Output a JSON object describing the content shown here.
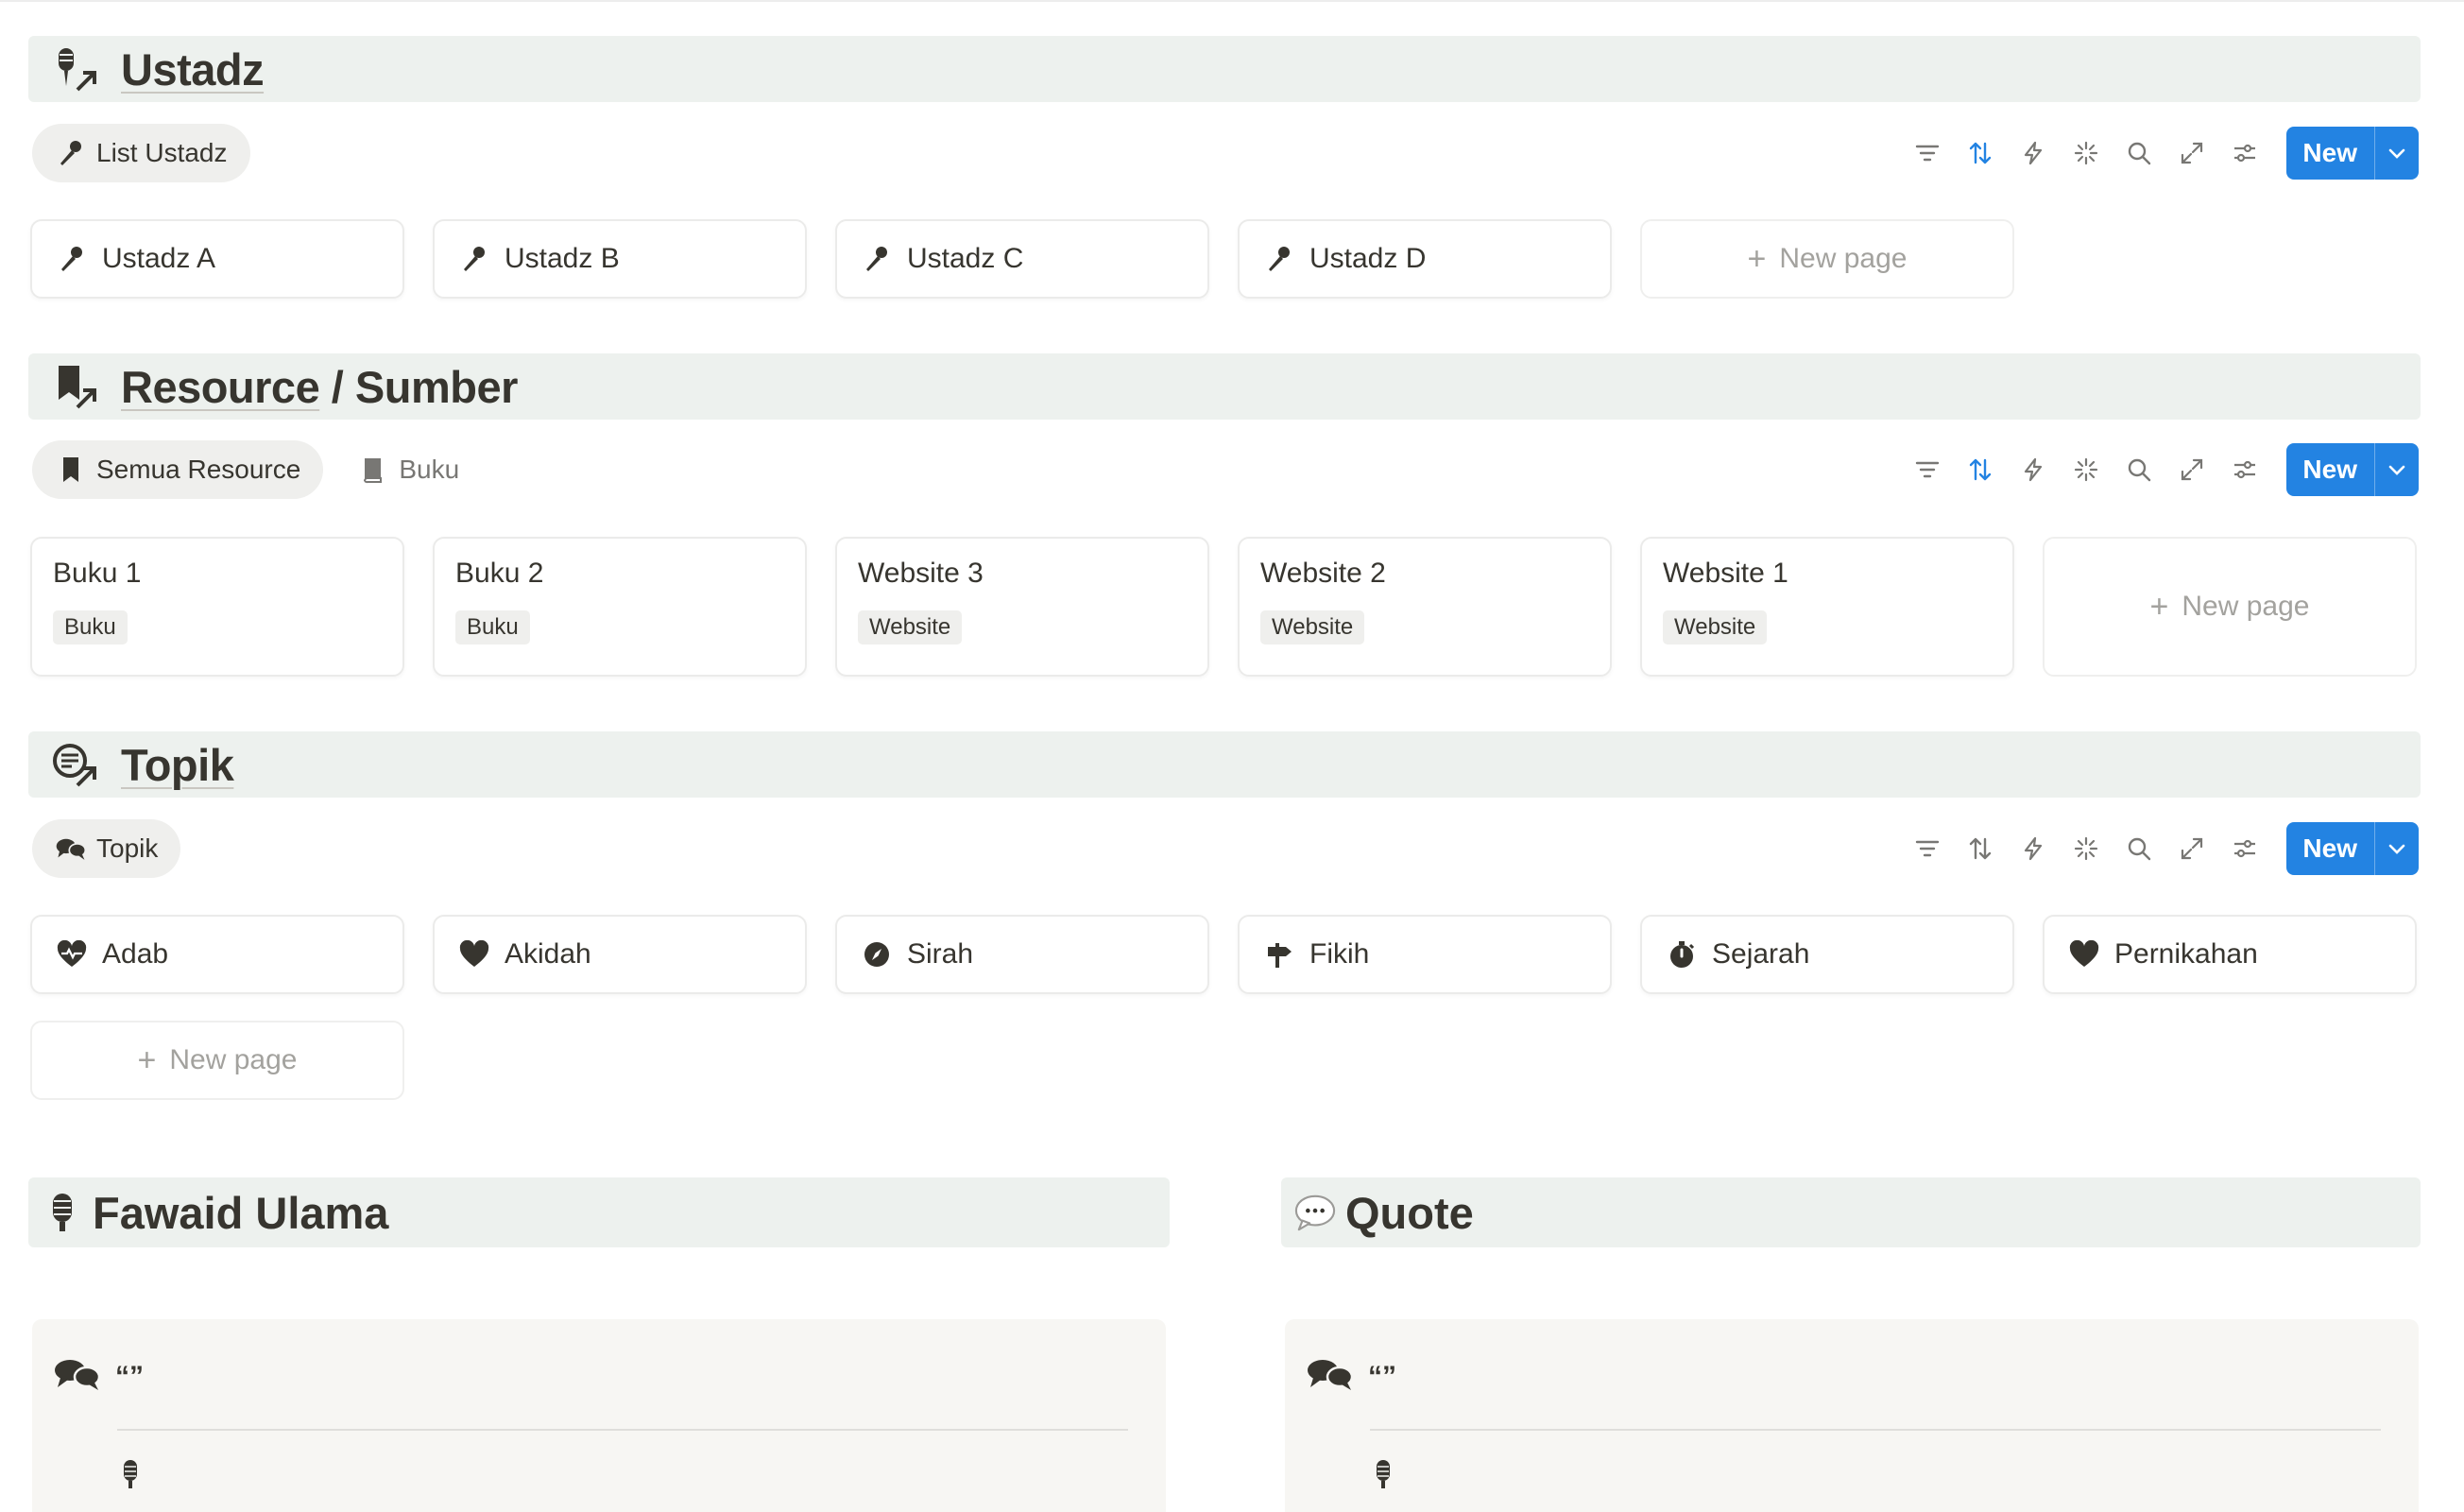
{
  "ustadz": {
    "title": "Ustadz",
    "tab": "List Ustadz",
    "items": [
      "Ustadz A",
      "Ustadz B",
      "Ustadz C",
      "Ustadz D"
    ],
    "new_page": "New page",
    "new_button": "New"
  },
  "resource": {
    "title_link": "Resource",
    "title_rest": " / Sumber",
    "tabs": [
      "Semua Resource",
      "Buku"
    ],
    "items": [
      {
        "title": "Buku 1",
        "tag": "Buku"
      },
      {
        "title": "Buku 2",
        "tag": "Buku"
      },
      {
        "title": "Website 3",
        "tag": "Website"
      },
      {
        "title": "Website 2",
        "tag": "Website"
      },
      {
        "title": "Website 1",
        "tag": "Website"
      }
    ],
    "new_page": "New page",
    "new_button": "New"
  },
  "topik": {
    "title": "Topik",
    "tab": "Topik",
    "items": [
      {
        "label": "Adab",
        "icon": "heart-pulse-icon"
      },
      {
        "label": "Akidah",
        "icon": "heart-icon"
      },
      {
        "label": "Sirah",
        "icon": "compass-icon"
      },
      {
        "label": "Fikih",
        "icon": "signpost-icon"
      },
      {
        "label": "Sejarah",
        "icon": "timer-icon"
      },
      {
        "label": "Pernikahan",
        "icon": "heart-icon"
      }
    ],
    "new_page": "New page",
    "new_button": "New"
  },
  "fawaid": {
    "title": "Fawaid Ulama",
    "quote": "“”"
  },
  "quote": {
    "title": "Quote",
    "quote": "“”"
  },
  "colors": {
    "accent": "#2383e2",
    "section_bg": "#edf1ee",
    "text": "#37352f"
  }
}
